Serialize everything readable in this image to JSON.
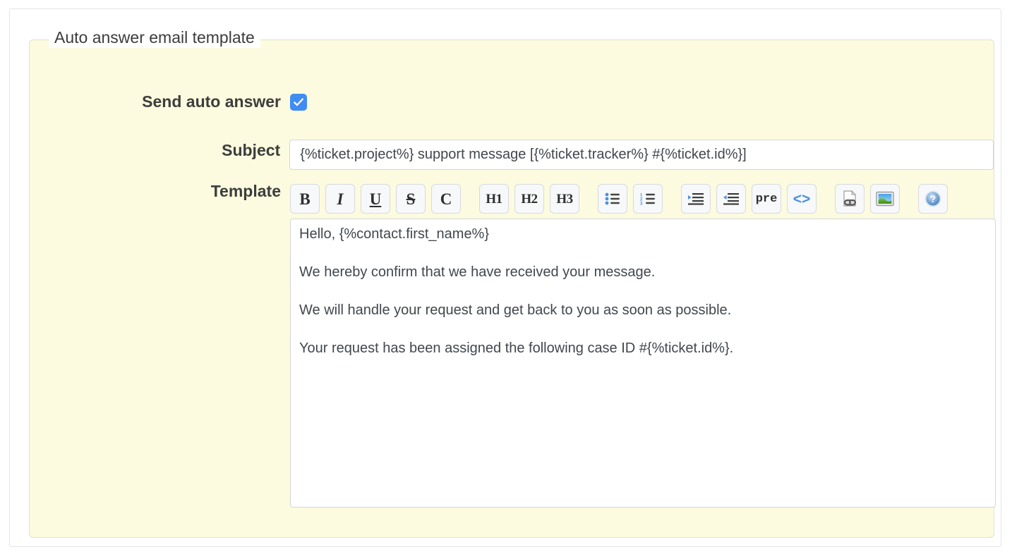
{
  "panel": {
    "legend": "Auto answer email template"
  },
  "fields": {
    "send_auto_answer": {
      "label": "Send auto answer",
      "checked": true
    },
    "subject": {
      "label": "Subject",
      "value": "{%ticket.project%} support message [{%ticket.tracker%} #{%ticket.id%}]",
      "placeholder": ""
    },
    "template": {
      "label": "Template",
      "value": "Hello, {%contact.first_name%}\n\nWe hereby confirm that we have received your message.\n\nWe will handle your request and get back to you as soon as possible.\n\nYour request has been assigned the following case ID #{%ticket.id%}.",
      "placeholder": ""
    }
  },
  "toolbar": {
    "groups": [
      {
        "name": "inline-formatting",
        "buttons": [
          {
            "name": "bold",
            "icon": "bold-icon",
            "label": "B"
          },
          {
            "name": "italic",
            "icon": "italic-icon",
            "label": "I"
          },
          {
            "name": "underline",
            "icon": "underline-icon",
            "label": "U"
          },
          {
            "name": "strikethrough",
            "icon": "strikethrough-icon",
            "label": "S"
          },
          {
            "name": "code-inline",
            "icon": "code-letter-icon",
            "label": "C"
          }
        ]
      },
      {
        "name": "headings-and-lists",
        "buttons": [
          {
            "name": "heading-1",
            "icon": "h1-icon",
            "label": "H1"
          },
          {
            "name": "heading-2",
            "icon": "h2-icon",
            "label": "H2"
          },
          {
            "name": "heading-3",
            "icon": "h3-icon",
            "label": "H3"
          },
          {
            "name": "unordered-list",
            "icon": "bullet-list-icon",
            "label": ""
          },
          {
            "name": "ordered-list",
            "icon": "numbered-list-icon",
            "label": ""
          }
        ]
      },
      {
        "name": "blocks",
        "buttons": [
          {
            "name": "indent",
            "icon": "indent-icon",
            "label": ""
          },
          {
            "name": "outdent",
            "icon": "outdent-icon",
            "label": ""
          },
          {
            "name": "preformat",
            "icon": "pre-icon",
            "label": "pre"
          },
          {
            "name": "code-block",
            "icon": "angle-brackets-icon",
            "label": "<>"
          }
        ]
      },
      {
        "name": "insert",
        "buttons": [
          {
            "name": "insert-link",
            "icon": "link-page-icon",
            "label": ""
          },
          {
            "name": "insert-image",
            "icon": "image-icon",
            "label": ""
          }
        ]
      },
      {
        "name": "help",
        "buttons": [
          {
            "name": "help",
            "icon": "question-mark-icon",
            "label": ""
          }
        ]
      }
    ]
  },
  "colors": {
    "fieldset_background": "#fcfbdf",
    "checkbox_accent": "#3f8cf3",
    "icon_accent": "#4a90e2",
    "text": "#3d3d3d",
    "input_text": "#41474d",
    "border": "#d4d7da"
  }
}
